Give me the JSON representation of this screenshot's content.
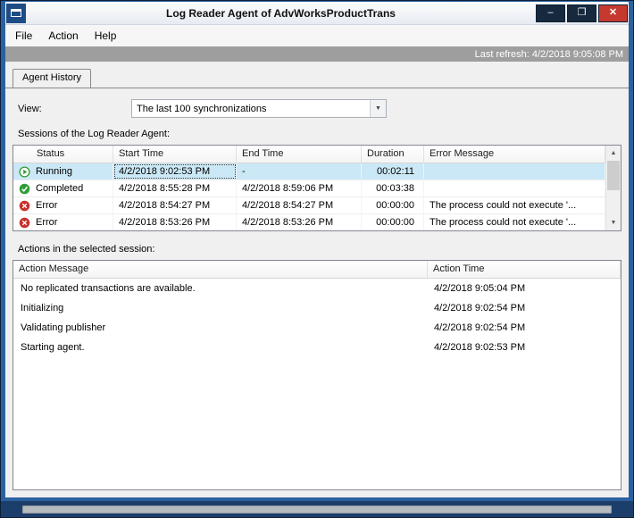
{
  "window": {
    "title": "Log Reader Agent of AdvWorksProductTrans"
  },
  "icons": {
    "minimize": "–",
    "maximize": "❐",
    "close": "✕",
    "dropdown_arrow": "▼",
    "scroll_up": "▲",
    "scroll_down": "▼"
  },
  "menu": {
    "items": [
      {
        "label": "File"
      },
      {
        "label": "Action"
      },
      {
        "label": "Help"
      }
    ]
  },
  "refresh_bar": {
    "text": "Last refresh: 4/2/2018 9:05:08 PM"
  },
  "tabs": [
    {
      "label": "Agent History"
    }
  ],
  "view": {
    "label": "View:",
    "value": "The last 100 synchronizations"
  },
  "sessions": {
    "caption": "Sessions of the Log Reader Agent:",
    "columns": [
      "Status",
      "Start Time",
      "End Time",
      "Duration",
      "Error Message"
    ],
    "rows": [
      {
        "status": "Running",
        "start": "4/2/2018 9:02:53 PM",
        "end": "-",
        "duration": "00:02:11",
        "error": ""
      },
      {
        "status": "Completed",
        "start": "4/2/2018 8:55:28 PM",
        "end": "4/2/2018 8:59:06 PM",
        "duration": "00:03:38",
        "error": ""
      },
      {
        "status": "Error",
        "start": "4/2/2018 8:54:27 PM",
        "end": "4/2/2018 8:54:27 PM",
        "duration": "00:00:00",
        "error": "The process could not execute '..."
      },
      {
        "status": "Error",
        "start": "4/2/2018 8:53:26 PM",
        "end": "4/2/2018 8:53:26 PM",
        "duration": "00:00:00",
        "error": "The process could not execute '..."
      }
    ]
  },
  "actions": {
    "caption": "Actions in the selected session:",
    "columns": [
      "Action Message",
      "Action Time"
    ],
    "rows": [
      {
        "message": "No replicated transactions are available.",
        "time": "4/2/2018 9:05:04 PM"
      },
      {
        "message": "Initializing",
        "time": "4/2/2018 9:02:54 PM"
      },
      {
        "message": "Validating publisher",
        "time": "4/2/2018 9:02:54 PM"
      },
      {
        "message": "Starting agent.",
        "time": "4/2/2018 9:02:53 PM"
      }
    ]
  },
  "colors": {
    "window_border": "#2c61a0",
    "selection": "#cbe8f6",
    "refresh_bar": "#9e9e9e",
    "close_button": "#c6392f",
    "status_running_green": "#2e9b2e",
    "status_completed_green": "#2f9e36",
    "status_error_red": "#c9302c"
  }
}
